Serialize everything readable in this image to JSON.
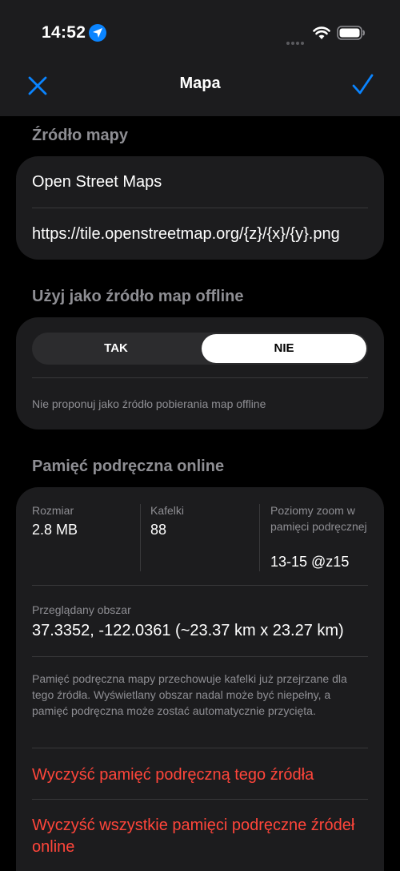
{
  "status_bar": {
    "time": "14:52"
  },
  "nav": {
    "title": "Mapa",
    "close_icon": "close-icon",
    "done_icon": "checkmark-icon"
  },
  "map_source": {
    "header": "Źródło mapy",
    "name": "Open Street Maps",
    "url": "https://tile.openstreetmap.org/{z}/{x}/{y}.png"
  },
  "offline": {
    "header": "Użyj jako źródło map offline",
    "options": [
      "TAK",
      "NIE"
    ],
    "selected": "NIE",
    "description": "Nie proponuj jako źródło pobierania map offline"
  },
  "cache": {
    "header": "Pamięć podręczna online",
    "size_label": "Rozmiar",
    "size_value": "2.8 MB",
    "tiles_label": "Kafelki",
    "tiles_value": "88",
    "zoom_label": "Poziomy zoom w pamięci podręcznej",
    "zoom_value": "13-15 @z15",
    "area_label": "Przeglądany obszar",
    "area_value": "37.3352, -122.0361  (~23.37 km x 23.27 km)",
    "note": "Pamięć podręczna mapy przechowuje kafelki już przejrzane dla tego źródła. Wyświetlany obszar nadal może być niepełny, a pamięć podręczna może zostać automatycznie przycięta.",
    "clear_source": "Wyczyść pamięć podręczną tego źródła",
    "clear_all": "Wyczyść wszystkie pamięci podręczne źródeł online"
  },
  "colors": {
    "accent": "#0a84ff",
    "destructive": "#ff453a",
    "card": "#1c1c1e"
  }
}
